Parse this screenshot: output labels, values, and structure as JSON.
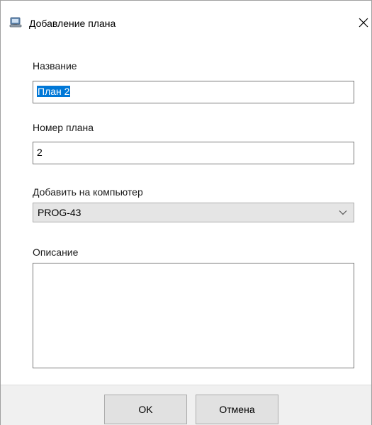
{
  "window": {
    "title": "Добавление плана",
    "close_icon": "close-icon",
    "app_icon": "computer-icon"
  },
  "form": {
    "name_label": "Название",
    "name_value": "План 2",
    "number_label": "Номер плана",
    "number_value": "2",
    "computer_label": "Добавить на компьютер",
    "computer_selected": "PROG-43",
    "description_label": "Описание",
    "description_value": ""
  },
  "buttons": {
    "ok_label": "OK",
    "cancel_label": "Отмена"
  },
  "colors": {
    "selection": "#0078d7",
    "button_face": "#e1e1e1",
    "combo_face": "#e5e5e5"
  }
}
